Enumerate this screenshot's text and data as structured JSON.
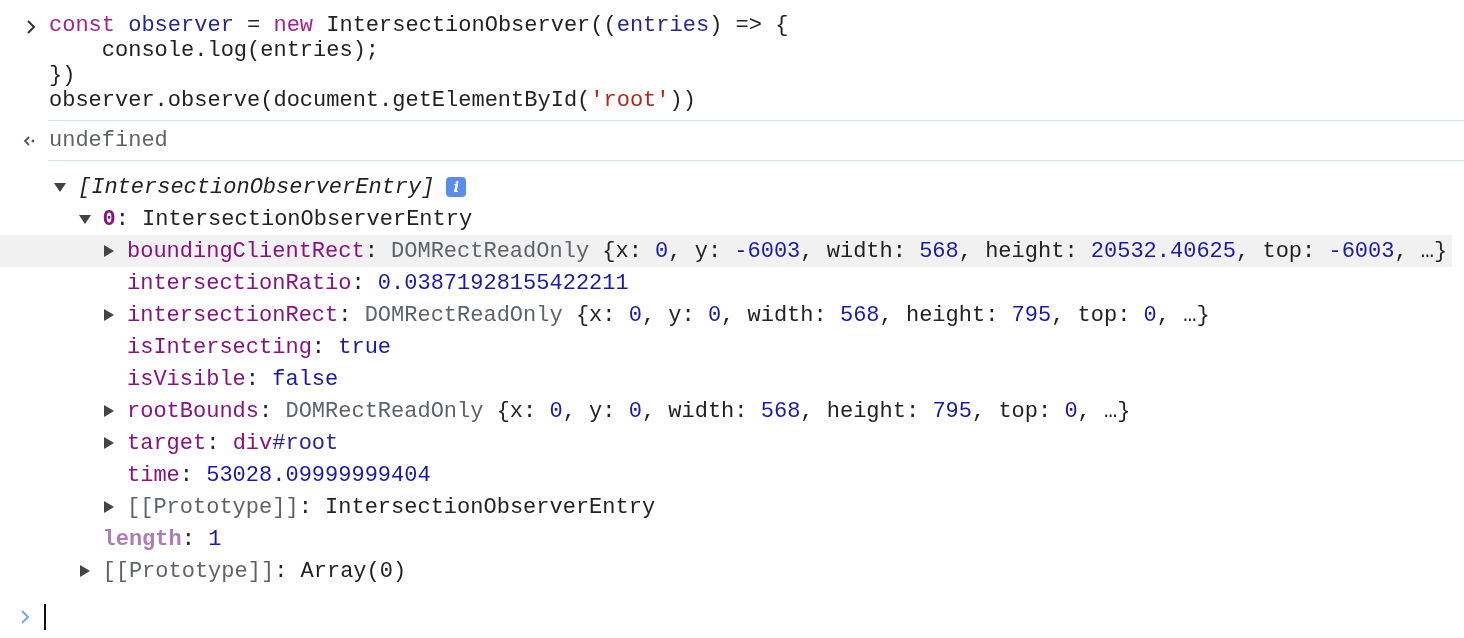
{
  "input": {
    "lines": [
      [
        {
          "text": "const ",
          "kind": "keyword"
        },
        {
          "text": "observer",
          "kind": "variable"
        },
        {
          "text": " = ",
          "kind": "plain"
        },
        {
          "text": "new ",
          "kind": "keyword"
        },
        {
          "text": "IntersectionObserver((",
          "kind": "plain"
        },
        {
          "text": "entries",
          "kind": "variable"
        },
        {
          "text": ") => {",
          "kind": "plain"
        }
      ],
      [
        {
          "text": "    console.log(entries);",
          "kind": "plain"
        }
      ],
      [
        {
          "text": "})",
          "kind": "plain"
        }
      ],
      [
        {
          "text": "observer.observe(document.getElementById(",
          "kind": "plain"
        },
        {
          "text": "'root'",
          "kind": "string"
        },
        {
          "text": "))",
          "kind": "plain"
        }
      ]
    ]
  },
  "result": {
    "tokens": [
      {
        "text": "undefined",
        "kind": "grey"
      }
    ]
  },
  "tree": [
    {
      "kind": "expandable",
      "expanded": true,
      "highlighted": false,
      "info_badge": "i",
      "tokens": [
        {
          "text": "[IntersectionObserverEntry]",
          "kind": "italic"
        }
      ],
      "children": [
        {
          "kind": "expandable",
          "expanded": true,
          "highlighted": false,
          "tokens": [
            {
              "text": "0",
              "kind": "index"
            },
            {
              "text": ": IntersectionObserverEntry",
              "kind": "plain"
            }
          ],
          "children": [
            {
              "kind": "expandable",
              "expanded": false,
              "highlighted": true,
              "tokens": [
                {
                  "text": "boundingClientRect",
                  "kind": "key"
                },
                {
                  "text": ": ",
                  "kind": "plain"
                },
                {
                  "text": "DOMRectReadOnly ",
                  "kind": "grey"
                },
                {
                  "text": "{x: ",
                  "kind": "plain"
                },
                {
                  "text": "0",
                  "kind": "number"
                },
                {
                  "text": ", y: ",
                  "kind": "plain"
                },
                {
                  "text": "-6003",
                  "kind": "number"
                },
                {
                  "text": ", width: ",
                  "kind": "plain"
                },
                {
                  "text": "568",
                  "kind": "number"
                },
                {
                  "text": ", height: ",
                  "kind": "plain"
                },
                {
                  "text": "20532.40625",
                  "kind": "number"
                },
                {
                  "text": ", top: ",
                  "kind": "plain"
                },
                {
                  "text": "-6003",
                  "kind": "number"
                },
                {
                  "text": ", …}",
                  "kind": "plain"
                }
              ]
            },
            {
              "kind": "leaf",
              "highlighted": false,
              "tokens": [
                {
                  "text": "intersectionRatio",
                  "kind": "key"
                },
                {
                  "text": ": ",
                  "kind": "plain"
                },
                {
                  "text": "0.03871928155422211",
                  "kind": "number"
                }
              ]
            },
            {
              "kind": "expandable",
              "expanded": false,
              "highlighted": false,
              "tokens": [
                {
                  "text": "intersectionRect",
                  "kind": "key"
                },
                {
                  "text": ": ",
                  "kind": "plain"
                },
                {
                  "text": "DOMRectReadOnly ",
                  "kind": "grey"
                },
                {
                  "text": "{x: ",
                  "kind": "plain"
                },
                {
                  "text": "0",
                  "kind": "number"
                },
                {
                  "text": ", y: ",
                  "kind": "plain"
                },
                {
                  "text": "0",
                  "kind": "number"
                },
                {
                  "text": ", width: ",
                  "kind": "plain"
                },
                {
                  "text": "568",
                  "kind": "number"
                },
                {
                  "text": ", height: ",
                  "kind": "plain"
                },
                {
                  "text": "795",
                  "kind": "number"
                },
                {
                  "text": ", top: ",
                  "kind": "plain"
                },
                {
                  "text": "0",
                  "kind": "number"
                },
                {
                  "text": ", …}",
                  "kind": "plain"
                }
              ]
            },
            {
              "kind": "leaf",
              "highlighted": false,
              "tokens": [
                {
                  "text": "isIntersecting",
                  "kind": "key"
                },
                {
                  "text": ": ",
                  "kind": "plain"
                },
                {
                  "text": "true",
                  "kind": "number"
                }
              ]
            },
            {
              "kind": "leaf",
              "highlighted": false,
              "tokens": [
                {
                  "text": "isVisible",
                  "kind": "key"
                },
                {
                  "text": ": ",
                  "kind": "plain"
                },
                {
                  "text": "false",
                  "kind": "number"
                }
              ]
            },
            {
              "kind": "expandable",
              "expanded": false,
              "highlighted": false,
              "tokens": [
                {
                  "text": "rootBounds",
                  "kind": "key"
                },
                {
                  "text": ": ",
                  "kind": "plain"
                },
                {
                  "text": "DOMRectReadOnly ",
                  "kind": "grey"
                },
                {
                  "text": "{x: ",
                  "kind": "plain"
                },
                {
                  "text": "0",
                  "kind": "number"
                },
                {
                  "text": ", y: ",
                  "kind": "plain"
                },
                {
                  "text": "0",
                  "kind": "number"
                },
                {
                  "text": ", width: ",
                  "kind": "plain"
                },
                {
                  "text": "568",
                  "kind": "number"
                },
                {
                  "text": ", height: ",
                  "kind": "plain"
                },
                {
                  "text": "795",
                  "kind": "number"
                },
                {
                  "text": ", top: ",
                  "kind": "plain"
                },
                {
                  "text": "0",
                  "kind": "number"
                },
                {
                  "text": ", …}",
                  "kind": "plain"
                }
              ]
            },
            {
              "kind": "expandable",
              "expanded": false,
              "highlighted": false,
              "tokens": [
                {
                  "text": "target",
                  "kind": "key"
                },
                {
                  "text": ": ",
                  "kind": "plain"
                },
                {
                  "text": "div",
                  "kind": "tag"
                },
                {
                  "text": "#root",
                  "kind": "variable"
                }
              ]
            },
            {
              "kind": "leaf",
              "highlighted": false,
              "tokens": [
                {
                  "text": "time",
                  "kind": "key"
                },
                {
                  "text": ": ",
                  "kind": "plain"
                },
                {
                  "text": "53028.09999999404",
                  "kind": "number"
                }
              ]
            },
            {
              "kind": "expandable",
              "expanded": false,
              "highlighted": false,
              "tokens": [
                {
                  "text": "[[Prototype]]",
                  "kind": "grey"
                },
                {
                  "text": ": IntersectionObserverEntry",
                  "kind": "plain"
                }
              ]
            }
          ]
        },
        {
          "kind": "leaf",
          "highlighted": false,
          "tokens": [
            {
              "text": "length",
              "kind": "dimkey"
            },
            {
              "text": ": ",
              "kind": "plain"
            },
            {
              "text": "1",
              "kind": "number"
            }
          ]
        },
        {
          "kind": "expandable",
          "expanded": false,
          "highlighted": false,
          "tokens": [
            {
              "text": "[[Prototype]]",
              "kind": "grey"
            },
            {
              "text": ": Array(0)",
              "kind": "plain"
            }
          ]
        }
      ]
    }
  ]
}
